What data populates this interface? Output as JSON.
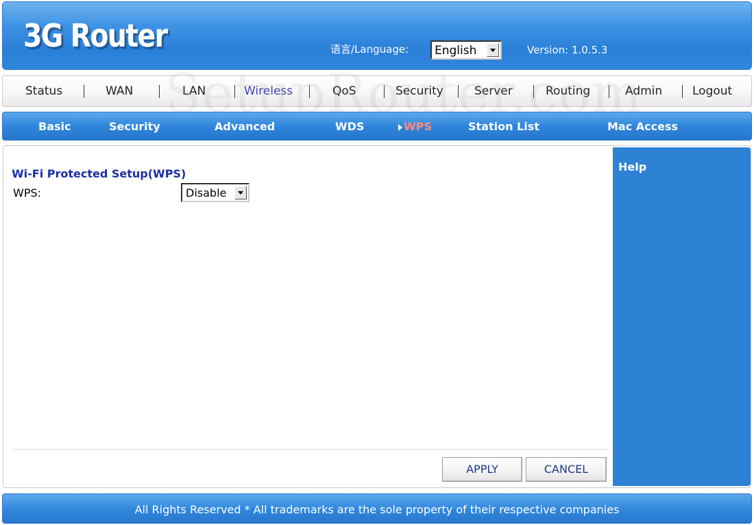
{
  "header": {
    "logo": "3G Router",
    "language_label": "语言/Language:",
    "language_value": "English",
    "version": "Version: 1.0.5.3"
  },
  "watermark": "SetupRouter.com",
  "main_nav": {
    "items": [
      "Status",
      "WAN",
      "LAN",
      "Wireless",
      "QoS",
      "Security",
      "Server",
      "Routing",
      "Admin",
      "Logout"
    ],
    "active": "Wireless"
  },
  "sub_nav": {
    "items": [
      "Basic",
      "Security",
      "Advanced",
      "WDS",
      "WPS",
      "Station List",
      "Mac Access"
    ],
    "active": "WPS"
  },
  "content": {
    "section_title": "Wi-Fi Protected Setup(WPS)",
    "wps_label": "WPS:",
    "wps_value": "Disable",
    "apply_label": "APPLY",
    "cancel_label": "CANCEL"
  },
  "help": {
    "title": "Help"
  },
  "footer": {
    "text": "All Rights Reserved * All trademarks are the sole property of their respective companies"
  },
  "colors": {
    "header_blue": "#2f86dc",
    "help_blue": "#2d82d6",
    "title_blue": "#1a2fa3",
    "active_subnav": "#ff8c7a",
    "active_mainnav": "#3f3fb0"
  }
}
